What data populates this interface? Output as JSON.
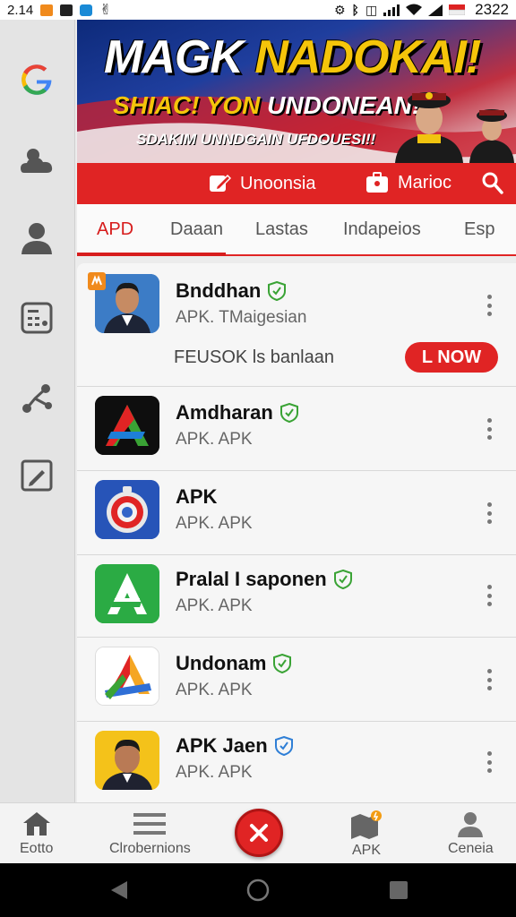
{
  "status_bar": {
    "time": "2.14",
    "clock": "2322"
  },
  "rail": {
    "items": [
      "google-icon",
      "weather-icon",
      "person-icon",
      "calculator-icon",
      "share-icon",
      "edit-icon"
    ]
  },
  "banner": {
    "headline_white": "MAGK ",
    "headline_yellow": "NADOKAI!",
    "sub_yellow": "SHIAC! YON ",
    "sub_white": "UNDONEAN!",
    "tagline": "SDAKIM UNNDGAIN UFDOUESI!!"
  },
  "redbar": {
    "left_label": "Unoonsia",
    "right_label": "Marioc"
  },
  "tabs": [
    "APD",
    "Daaan",
    "Lastas",
    "Indapeios",
    "Esp"
  ],
  "apps": [
    {
      "name": "Bnddhan",
      "sub": "APK. TMaigesian",
      "verified": true,
      "icon": "portrait-icon"
    },
    {
      "name": "Amdharan",
      "sub": "APK. APK",
      "verified": true,
      "icon": "triangle-logo-icon"
    },
    {
      "name": "APK",
      "sub": "APK. APK",
      "verified": false,
      "icon": "target-icon"
    },
    {
      "name": "Pralal I saponen",
      "sub": "APK. APK",
      "verified": true,
      "icon": "letter-a-icon"
    },
    {
      "name": "Undonam",
      "sub": "APK. APK",
      "verified": true,
      "icon": "stacked-a-icon"
    },
    {
      "name": "APK Jaen",
      "sub": "APK. APK",
      "verified": true,
      "icon": "portrait-icon"
    }
  ],
  "promo": {
    "text": "FEUSOK ls banlaan",
    "button": "L NOW"
  },
  "bottom_nav": {
    "home": "Eotto",
    "menu": "Clrobernions",
    "apk": "APK",
    "profile": "Ceneia"
  },
  "colors": {
    "accent": "#e02424",
    "verified": "#3aa335"
  }
}
